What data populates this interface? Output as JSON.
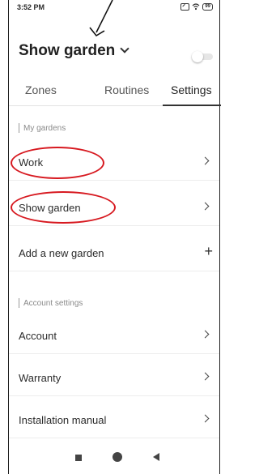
{
  "status_bar": {
    "time": "3:52 PM",
    "battery": "99"
  },
  "header": {
    "garden_name": "Show garden"
  },
  "tabs": [
    {
      "label": "Zones"
    },
    {
      "label": "Routines"
    },
    {
      "label": "Settings",
      "active": true
    }
  ],
  "my_gardens": {
    "section_label": "My gardens",
    "items": [
      {
        "label": "Work"
      },
      {
        "label": "Show garden"
      },
      {
        "label": "Add a new garden"
      }
    ],
    "add_icon": "+"
  },
  "account_settings": {
    "section_label": "Account settings",
    "items": [
      {
        "label": "Account"
      },
      {
        "label": "Warranty"
      },
      {
        "label": "Installation manual"
      }
    ]
  },
  "annotation_color": "#d71920"
}
